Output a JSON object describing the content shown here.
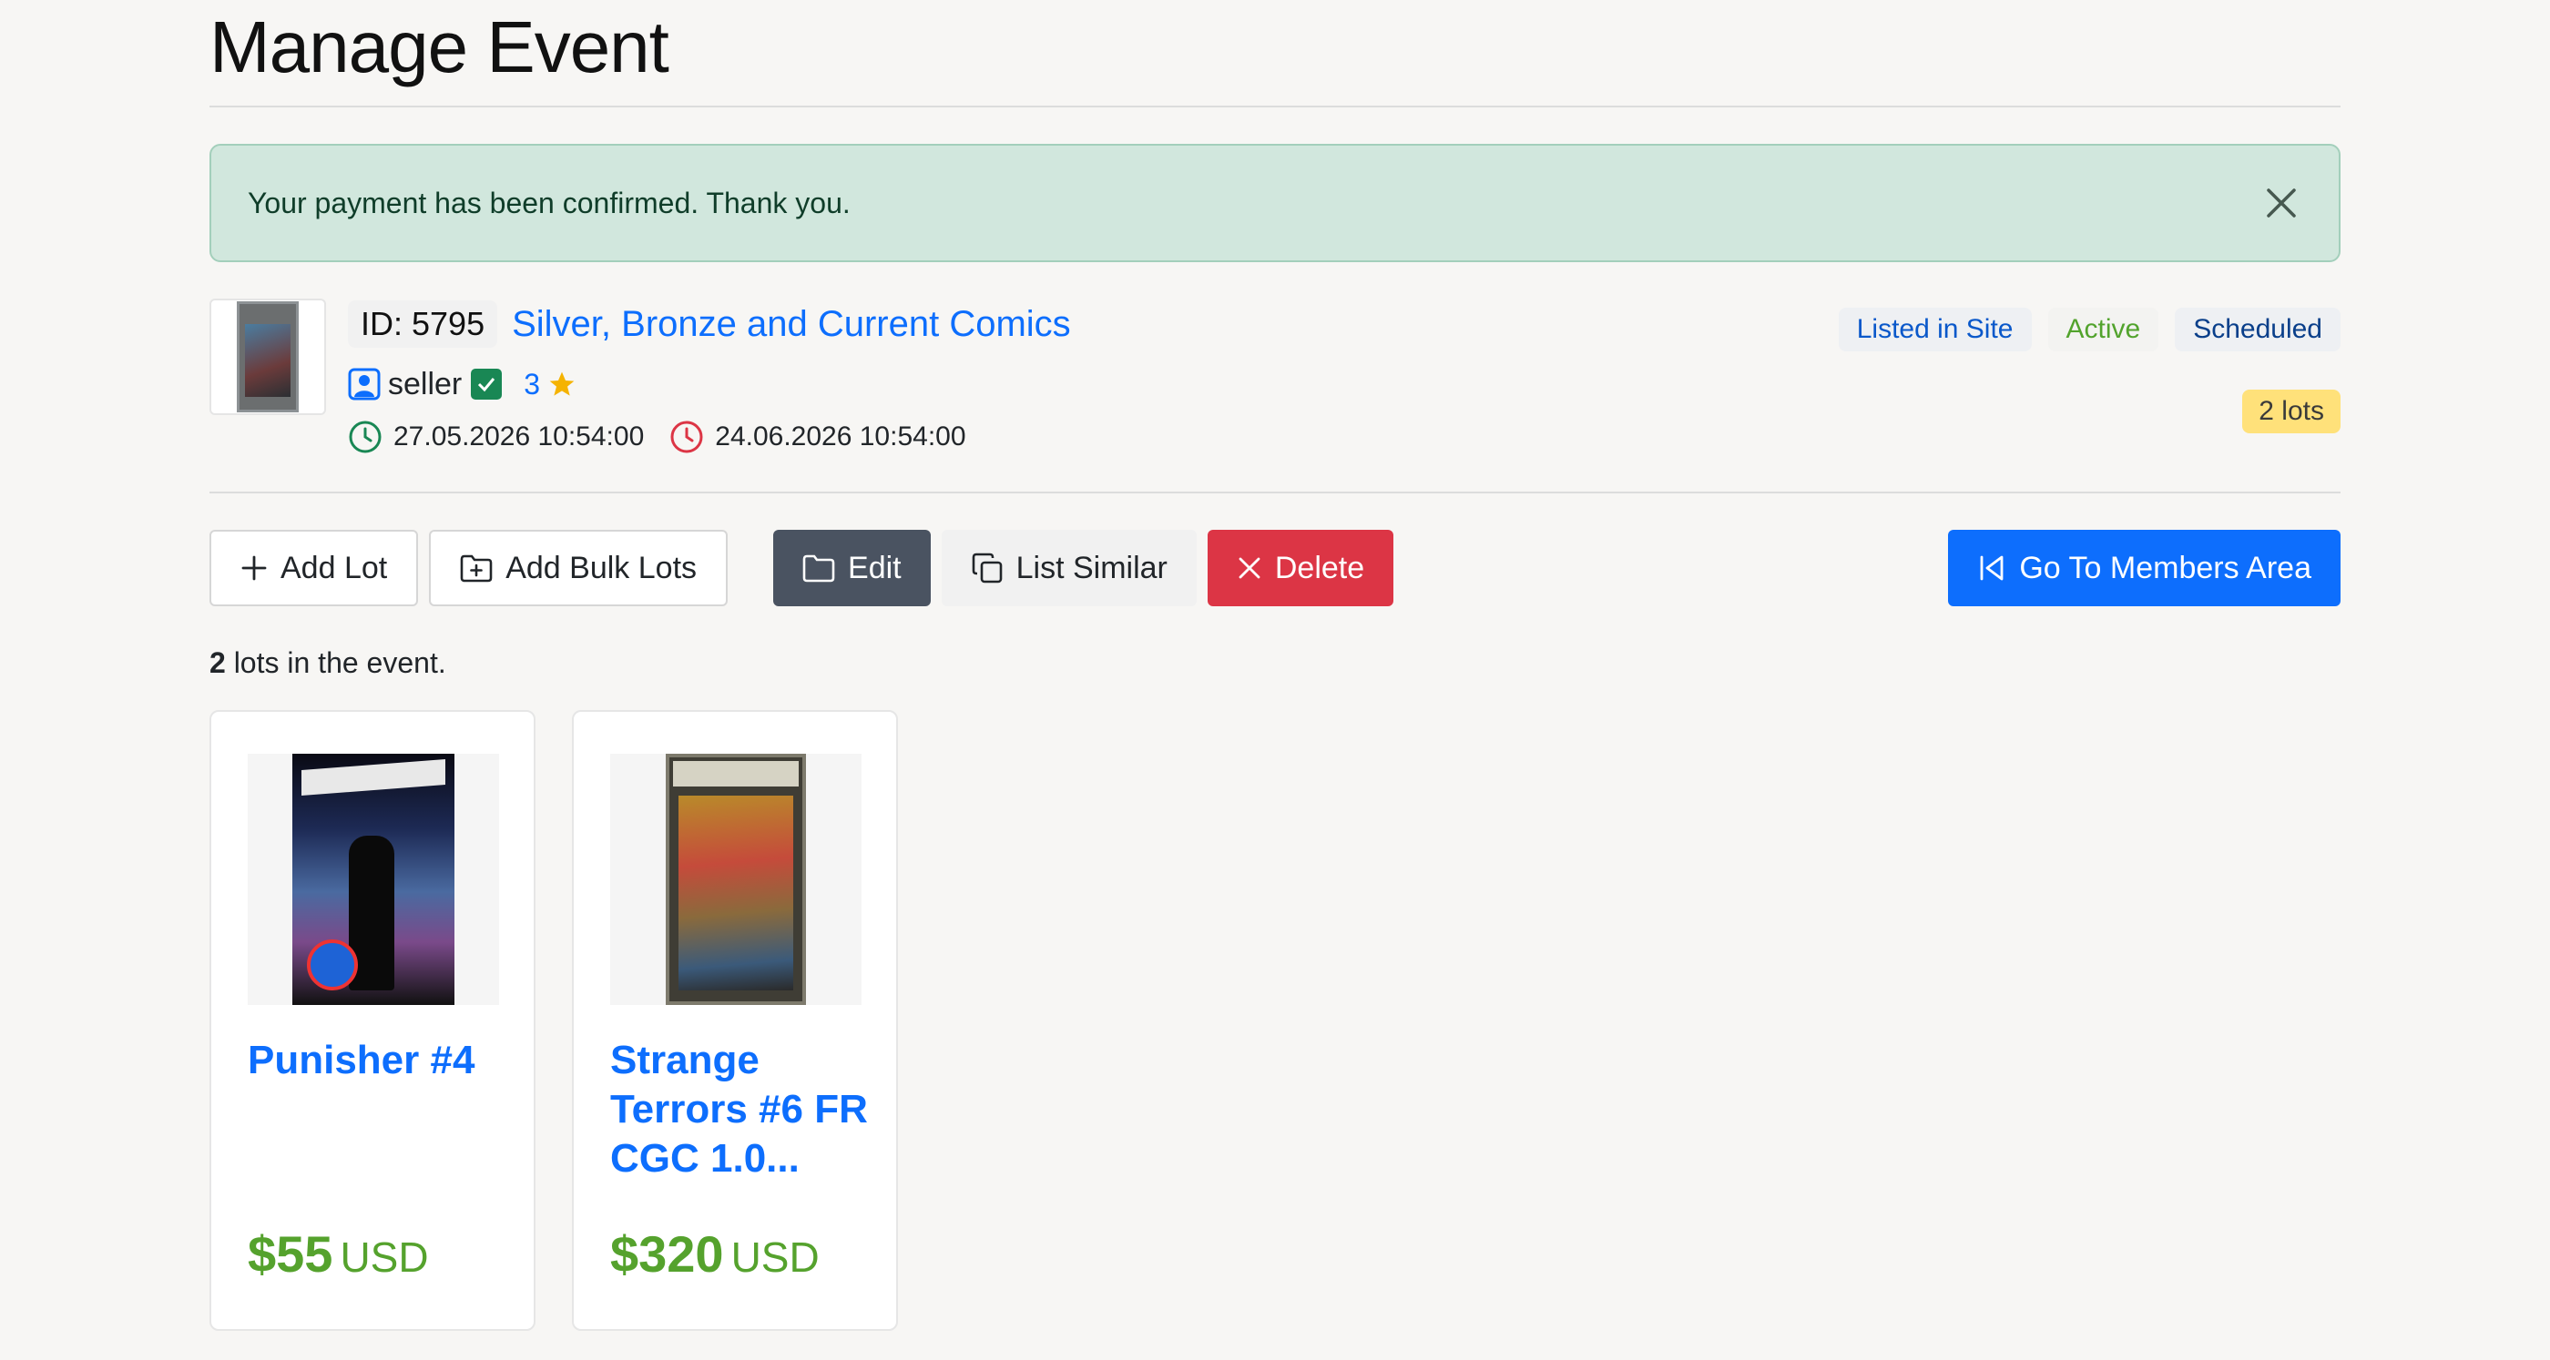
{
  "page": {
    "title": "Manage Event"
  },
  "alert": {
    "message": "Your payment has been confirmed. Thank you."
  },
  "event": {
    "id_label": "ID: 5795",
    "name": "Silver, Bronze and Current Comics",
    "seller": "seller",
    "rating": "3",
    "start_date": "27.05.2026 10:54:00",
    "end_date": "24.06.2026 10:54:00",
    "badges": {
      "listed": "Listed in Site",
      "active": "Active",
      "scheduled": "Scheduled",
      "lots": "2 lots"
    }
  },
  "toolbar": {
    "add_lot": "Add Lot",
    "add_bulk": "Add Bulk Lots",
    "edit": "Edit",
    "list_similar": "List Similar",
    "delete": "Delete",
    "members": "Go To Members Area"
  },
  "summary": {
    "count": "2",
    "suffix": " lots in the event."
  },
  "lots": [
    {
      "title": "Punisher #4",
      "price": "$55",
      "currency": "USD"
    },
    {
      "title": "Strange Terrors #6 FR CGC 1.0...",
      "price": "$320",
      "currency": "USD"
    }
  ],
  "colors": {
    "link": "#0d6efd",
    "price": "#55a22d",
    "danger": "#dc3545",
    "success_bg": "#d1e7dd"
  },
  "icons": [
    "close-icon",
    "user-icon",
    "check-icon",
    "star-icon",
    "clock-icon",
    "plus-icon",
    "folder-plus-icon",
    "folder-icon",
    "copy-icon",
    "x-icon",
    "skip-back-icon"
  ]
}
